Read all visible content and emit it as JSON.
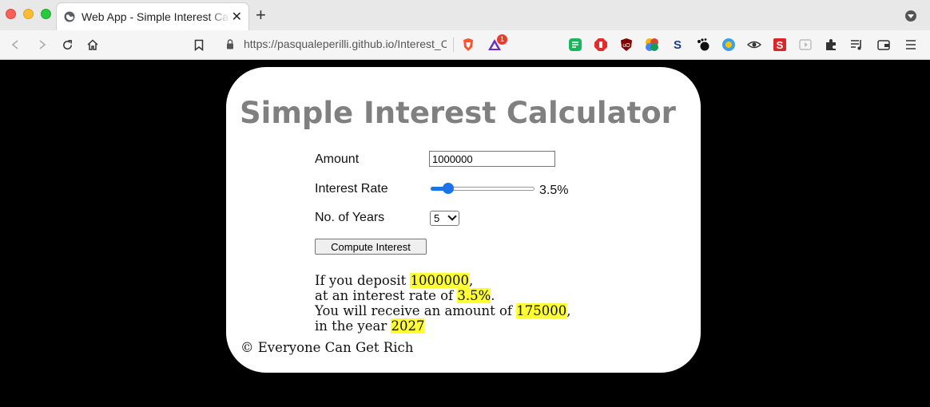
{
  "browser": {
    "tab_title": "Web App - Simple Interest Calculator",
    "url": "https://pasqualeperilli.github.io/Interest_Calculator/",
    "extensions_badge": "1"
  },
  "app": {
    "title": "Simple Interest Calculator",
    "amount_label": "Amount",
    "amount_value": "1000000",
    "rate_label": "Interest Rate",
    "rate_display": "3.5%",
    "rate_slider_value": 3.5,
    "rate_slider_min": 1,
    "rate_slider_max": 20,
    "years_label": "No. of Years",
    "years_selected": "5",
    "compute_button": "Compute Interest",
    "footer": "© Everyone Can Get Rich"
  },
  "result": {
    "line1_prefix": "If you deposit ",
    "deposit": "1000000",
    "line1_suffix": ",",
    "line2_prefix": "at an interest rate of ",
    "rate": "3.5%",
    "line2_suffix": ".",
    "line3_prefix": "You will receive an amount of ",
    "interest": "175000",
    "line3_suffix": ",",
    "line4_prefix": "in the year ",
    "year": "2027"
  },
  "colors": {
    "page_background": "#000000",
    "card_background": "#ffffff",
    "title_color": "#808080",
    "highlight": "#ffff33",
    "slider_accent": "#1a73e8"
  }
}
